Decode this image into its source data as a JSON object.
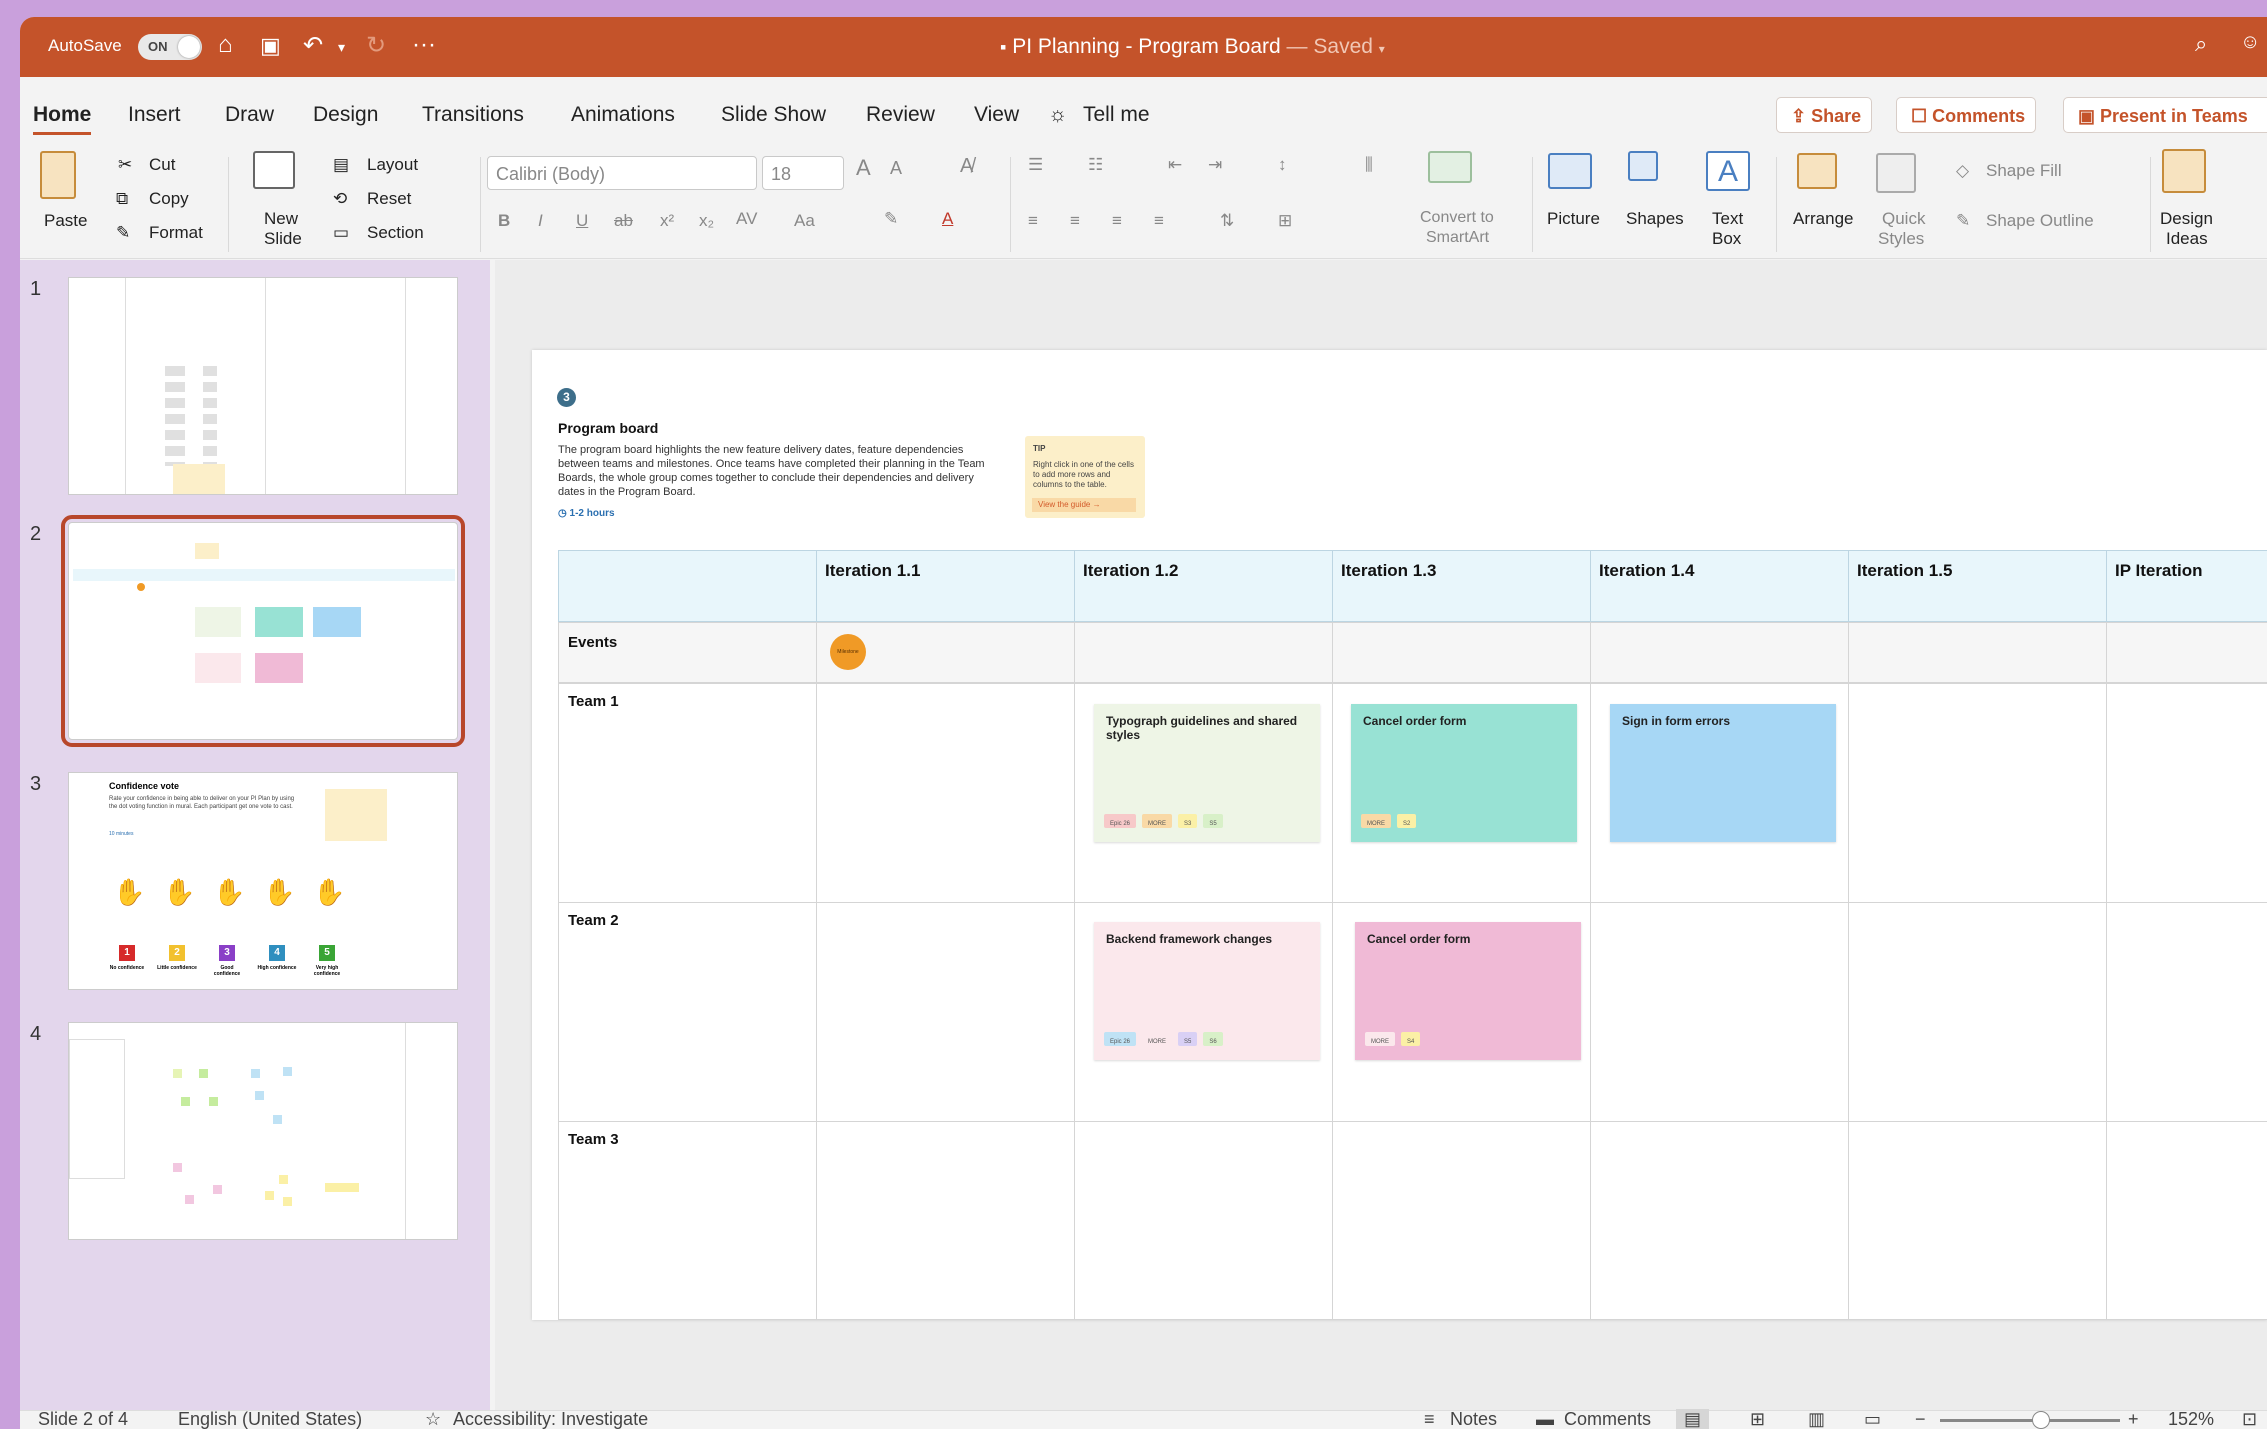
{
  "titlebar": {
    "autosave_label": "AutoSave",
    "autosave_state": "ON",
    "doc_title": "PI Planning - Program Board",
    "saved_label": "— Saved"
  },
  "tabs": [
    "Home",
    "Insert",
    "Draw",
    "Design",
    "Transitions",
    "Animations",
    "Slide Show",
    "Review",
    "View"
  ],
  "tell_me": "Tell me",
  "actions": {
    "share": "Share",
    "comments": "Comments",
    "present": "Present in Teams"
  },
  "ribbon": {
    "paste": "Paste",
    "cut": "Cut",
    "copy": "Copy",
    "format": "Format",
    "new_slide_1": "New",
    "new_slide_2": "Slide",
    "layout": "Layout",
    "reset": "Reset",
    "section": "Section",
    "font_name": "Calibri (Body)",
    "font_size": "18",
    "convert_1": "Convert to",
    "convert_2": "SmartArt",
    "picture": "Picture",
    "shapes": "Shapes",
    "textbox_1": "Text",
    "textbox_2": "Box",
    "arrange": "Arrange",
    "quick_1": "Quick",
    "quick_2": "Styles",
    "shape_fill": "Shape Fill",
    "shape_outline": "Shape Outline",
    "design_1": "Design",
    "design_2": "Ideas"
  },
  "thumbnails": {
    "numbers": [
      "1",
      "2",
      "3",
      "4"
    ],
    "slide3_title": "Confidence vote",
    "slide3_text": "Rate your confidence in being able to deliver on your PI Plan by using the dot voting function in mural. Each participant get one vote to cast.",
    "slide3_time": "10 minutes",
    "slide3_votes": [
      {
        "n": "1",
        "label": "No confidence",
        "color": "#d62a2a"
      },
      {
        "n": "2",
        "label": "Little confidence",
        "color": "#f2c12e"
      },
      {
        "n": "3",
        "label": "Good confidence",
        "color": "#8a3fc7"
      },
      {
        "n": "4",
        "label": "High confidence",
        "color": "#2f8fbf"
      },
      {
        "n": "5",
        "label": "Very high confidence",
        "color": "#3aa536"
      }
    ]
  },
  "slide": {
    "step": "3",
    "title": "Program board",
    "description": "The program board highlights the new feature delivery dates, feature dependencies between teams and milestones. Once teams have completed their planning in the Team Boards, the whole group comes together to conclude their dependencies and delivery dates in the Program Board.",
    "time": "1-2 hours",
    "tip_title": "TIP",
    "tip_text": "Right click in one of the cells to add more rows and columns to the table.",
    "tip_button": "View the guide",
    "columns": [
      "",
      "Iteration 1.1",
      "Iteration 1.2",
      "Iteration 1.3",
      "Iteration 1.4",
      "Iteration 1.5",
      "IP Iteration"
    ],
    "rows": [
      "Events",
      "Team 1",
      "Team 2",
      "Team 3"
    ],
    "milestone": "Milestone",
    "stickies": [
      {
        "text": "Typograph guidelines and shared styles",
        "color": "#eef5e6"
      },
      {
        "text": "Cancel order form",
        "color": "#98e2d4"
      },
      {
        "text": "Sign in form errors",
        "color": "#a7d7f5"
      },
      {
        "text": "Backend framework changes",
        "color": "#fbe8ec"
      },
      {
        "text": "Cancel order form",
        "color": "#f0bad6"
      }
    ],
    "tags": {
      "s1": [
        "Epic 26",
        "MORE",
        "S3",
        "S5"
      ],
      "s2": [
        "MORE",
        "S2"
      ],
      "s4": [
        "Epic 26",
        "MORE",
        "S5",
        "S6"
      ],
      "s5": [
        "MORE",
        "S4"
      ]
    }
  },
  "status": {
    "slide": "Slide 2 of 4",
    "language": "English (United States)",
    "accessibility": "Accessibility: Investigate",
    "notes": "Notes",
    "comments": "Comments",
    "zoom": "152%"
  }
}
